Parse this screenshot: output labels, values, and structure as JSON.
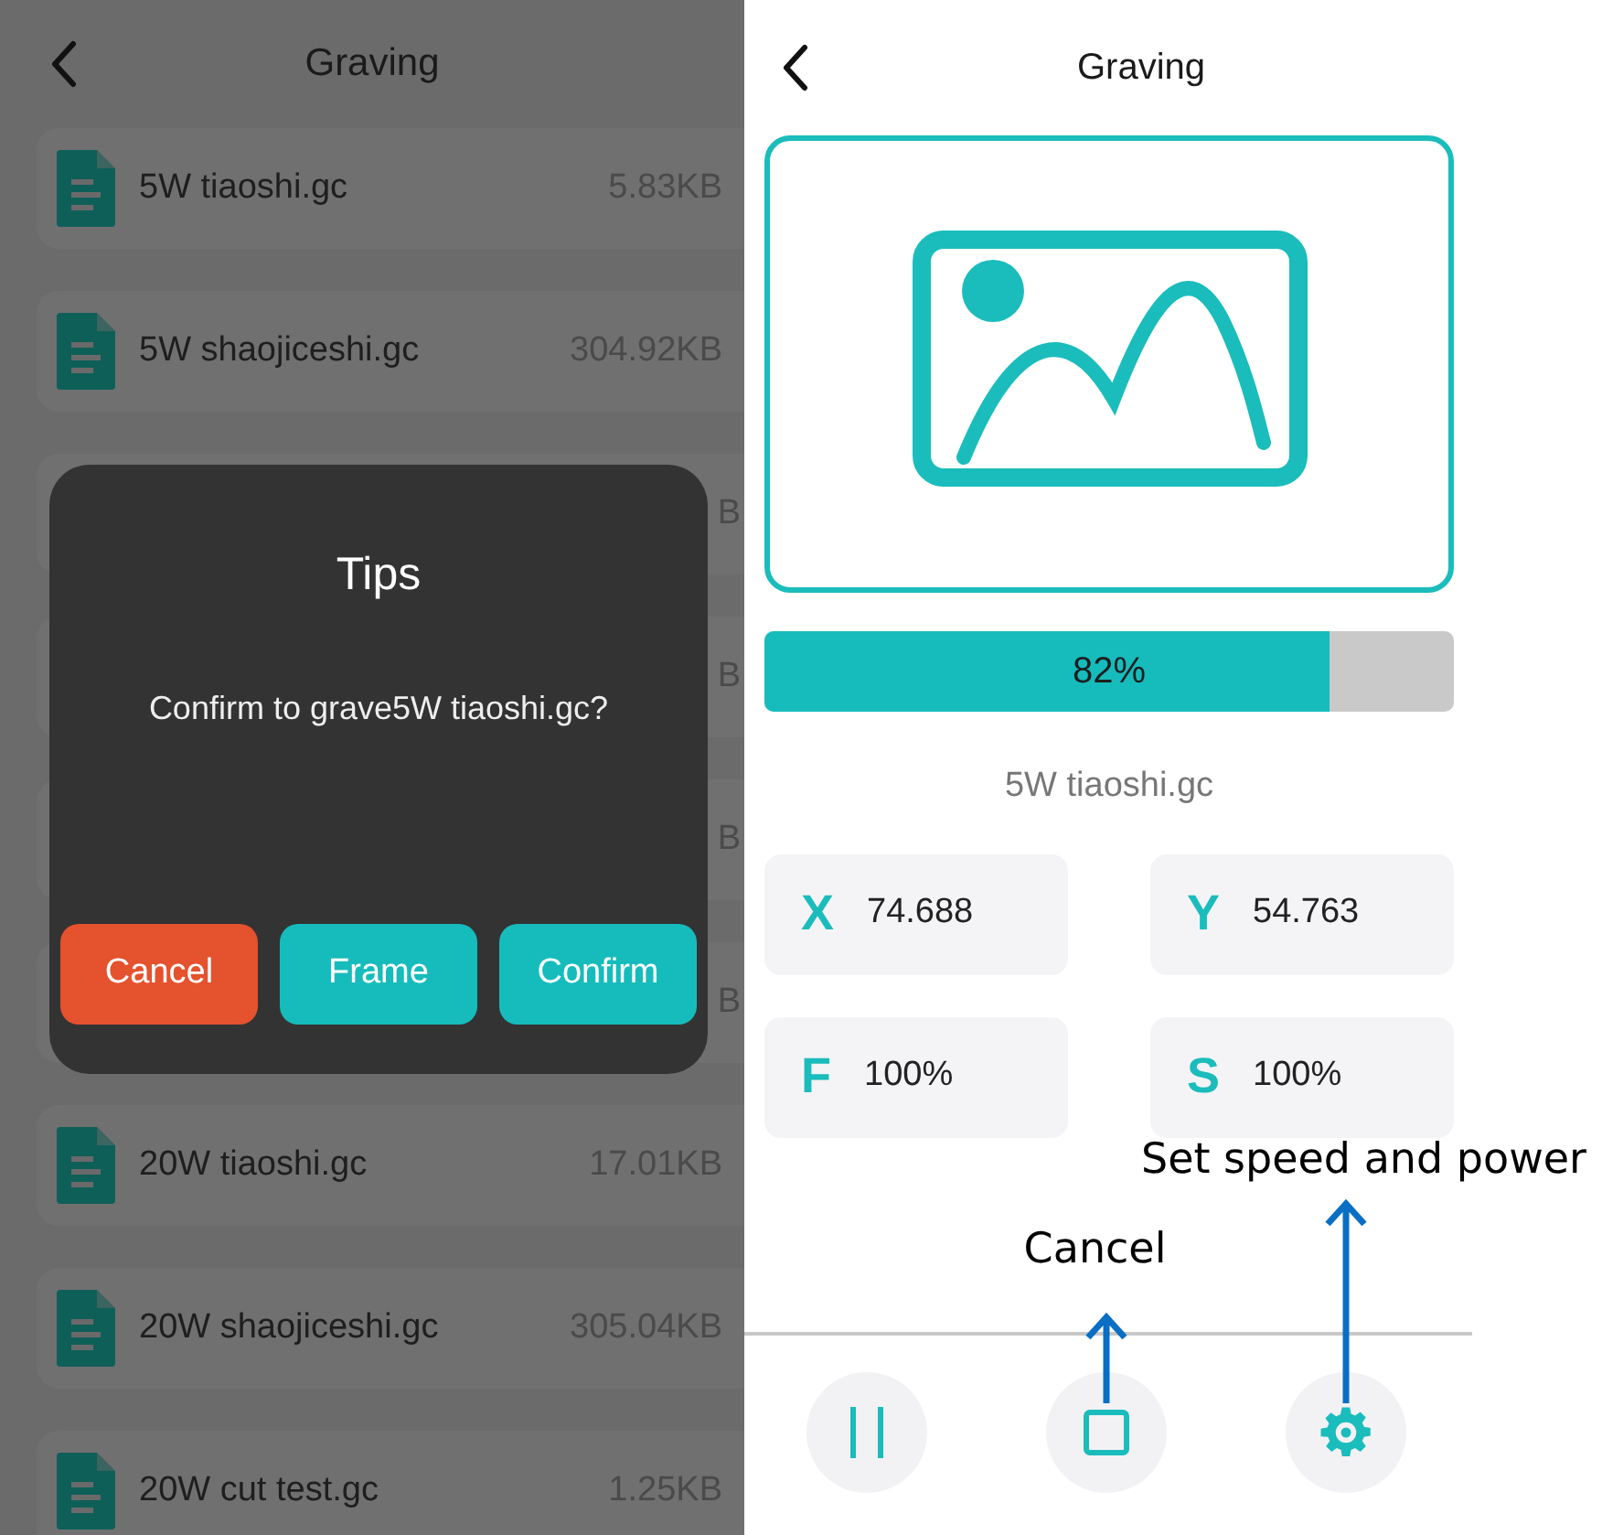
{
  "left_screen": {
    "header": {
      "title": "Graving"
    },
    "files": [
      {
        "kind": "file",
        "name": "5W tiaoshi.gc",
        "size": "5.83KB"
      },
      {
        "kind": "file",
        "name": "5W shaojiceshi.gc",
        "size": "304.92KB"
      },
      {
        "kind": "covered",
        "size": "B"
      },
      {
        "kind": "covered",
        "size": "B"
      },
      {
        "kind": "covered",
        "size": "B"
      },
      {
        "kind": "covered",
        "size": "B"
      },
      {
        "kind": "file",
        "name": "20W tiaoshi.gc",
        "size": "17.01KB"
      },
      {
        "kind": "file",
        "name": "20W shaojiceshi.gc",
        "size": "305.04KB"
      },
      {
        "kind": "file",
        "name": "20W cut test.gc",
        "size": "1.25KB"
      }
    ],
    "dialog": {
      "title": "Tips",
      "message": "Confirm to grave5W tiaoshi.gc?",
      "buttons": [
        {
          "label": "Cancel",
          "kind": "danger"
        },
        {
          "label": "Frame",
          "kind": "primary"
        },
        {
          "label": "Confirm",
          "kind": "primary"
        }
      ]
    }
  },
  "right_screen": {
    "header": {
      "title": "Graving"
    },
    "progress": {
      "level": 0.82,
      "reading": "82%"
    },
    "file_name": "5W tiaoshi.gc",
    "stats": [
      {
        "axis": "X",
        "value": "74.688"
      },
      {
        "axis": "Y",
        "value": "54.763"
      },
      {
        "axis": "F",
        "value": "100%"
      },
      {
        "axis": "S",
        "value": "100%"
      }
    ],
    "controls": [
      {
        "kind": "pause"
      },
      {
        "kind": "stop",
        "annotation": "Cancel"
      },
      {
        "kind": "settings",
        "annotation": "Set speed and power"
      }
    ]
  }
}
